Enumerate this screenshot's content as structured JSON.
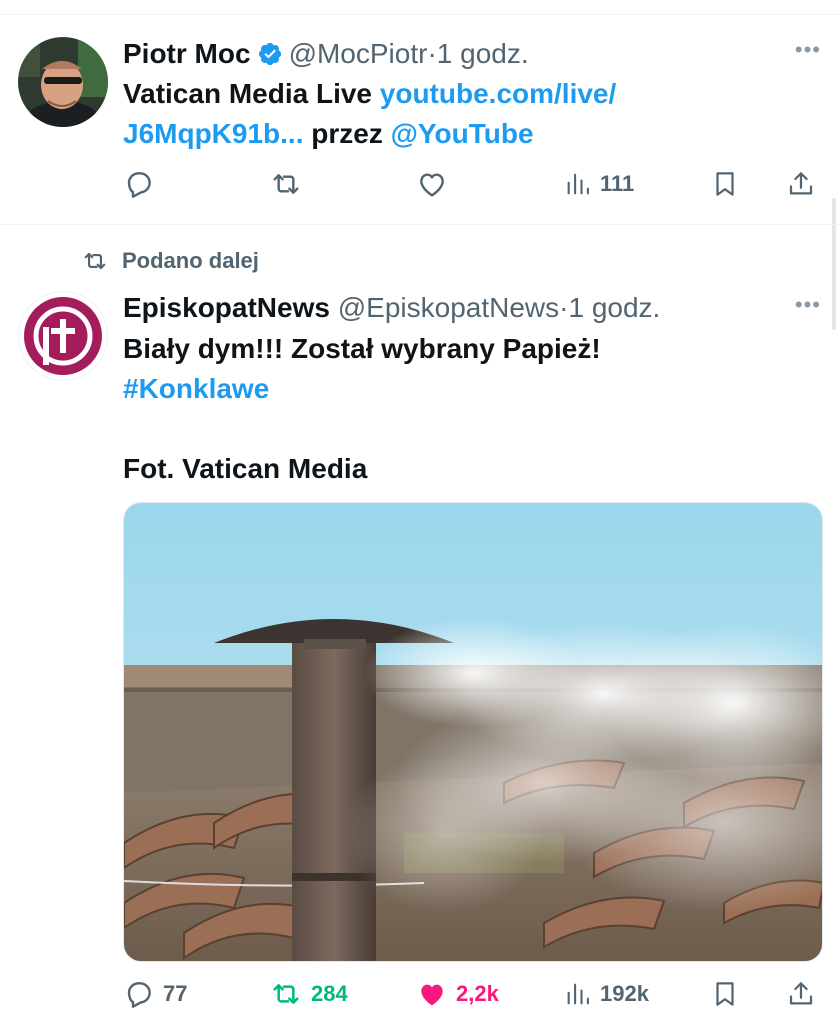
{
  "tweet1": {
    "name": "Piotr Moc",
    "handle": "@MocPiotr",
    "separator": "·",
    "time": "1 godz.",
    "text_prefix": "Vatican Media Live ",
    "link1": "youtube.com/live/",
    "link2": "J6MqpK91b...",
    "text_mid": " przez ",
    "mention": "@YouTube",
    "views": "111"
  },
  "tweet2": {
    "retweeted_label": "Podano dalej",
    "name": "EpiskopatNews",
    "handle": "@EpiskopatNews",
    "separator": "·",
    "time": "1 godz.",
    "line1": "Biały dym!!! Został wybrany Papież!",
    "hashtag": "#Konklawe",
    "line3": "Fot. Vatican Media",
    "replies": "77",
    "retweets": "284",
    "likes": "2,2k",
    "views": "192k"
  },
  "colors": {
    "link": "#1d9bf0",
    "retweet_green": "#00ba7c",
    "like_pink": "#f91880",
    "muted": "#536471",
    "episkopat_brand": "#a51c5c"
  },
  "icons": [
    "verified-badge-icon",
    "more-icon",
    "reply-icon",
    "retweet-icon",
    "like-icon",
    "views-icon",
    "bookmark-icon",
    "share-icon"
  ]
}
